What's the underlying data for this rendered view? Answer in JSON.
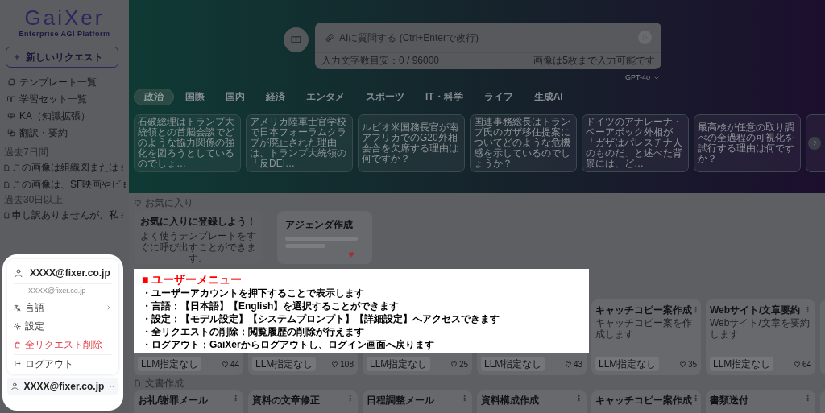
{
  "sidebar": {
    "logo": "GaiXer",
    "tagline": "Enterprise AGI Platform",
    "new_request": "新しいリクエスト",
    "nav": [
      {
        "label": "テンプレート一覧"
      },
      {
        "label": "学習セット一覧"
      },
      {
        "label": "KA（知識拡張）"
      },
      {
        "label": "翻訳・要約"
      }
    ],
    "history": [
      {
        "heading": "過去7日間",
        "items": [
          "この画像は組織図または",
          "この画像は、SF映画やビ"
        ]
      },
      {
        "heading": "過去30日以上",
        "items": [
          "申し訳ありませんが、私"
        ]
      }
    ]
  },
  "hero": {
    "placeholder": "AIに質問する (Ctrl+Enterで改行)",
    "char_count": "入力文字数目安：0 / 96000",
    "image_note": "画像は5枚まで入力可能です",
    "model": "GPT-4o",
    "categories": [
      {
        "label": "政治",
        "selected": true
      },
      {
        "label": "国際",
        "selected": false
      },
      {
        "label": "国内",
        "selected": false
      },
      {
        "label": "経済",
        "selected": false
      },
      {
        "label": "エンタメ",
        "selected": false
      },
      {
        "label": "スポーツ",
        "selected": false
      },
      {
        "label": "IT・科学",
        "selected": false
      },
      {
        "label": "ライフ",
        "selected": false
      },
      {
        "label": "生成AI",
        "selected": false
      }
    ],
    "news": [
      "石破総理はトランプ大統領との首脳会談でどのような協力関係の強化を図ろうとしているのでしょ…",
      "アメリカ陸軍士官学校で日本フォーラムクラブが廃止された理由は、トランプ大統領の「反DEI…",
      "ルビオ米国務長官が南アフリカでのG20外相会合を欠席する理由は何ですか？",
      "国連事務総長はトランプ氏のガザ移住提案についてどのような危機感を示しているのでしょうか？",
      "ドイツのアナレーナ・ベーアボック外相が「ガザはパレスチナ人のものだ」と述べた背景には、ど…",
      "最高検が任意の取り調べの全過程の可視化を試行する理由は何ですか？"
    ]
  },
  "favorites": {
    "heading": "お気に入り",
    "empty_title": "お気に入りに登録しよう！",
    "empty_text": "よく使うテンプレートをすぐに呼び出すことができます。",
    "card_title": "アジェンダ作成"
  },
  "templates": [
    {
      "llm": "LLM指定なし",
      "likes": "44"
    },
    {
      "llm": "LLM指定なし",
      "likes": "108"
    },
    {
      "llm": "LLM指定なし",
      "likes": "25"
    },
    {
      "llm": "LLM指定なし",
      "likes": "43"
    },
    {
      "title": "キャッチコピー案作成",
      "description": "キャッチコピー案を作成します",
      "llm": "LLM指定なし",
      "likes": "35"
    },
    {
      "title": "Webサイト/文章要約",
      "description": "Webサイト/文章を要約します",
      "llm": "LLM指定なし",
      "likes": "64"
    }
  ],
  "documents": {
    "heading": "文書作成",
    "cards": [
      "お礼/謝罪メール",
      "資料の文章修正",
      "日程調整メール",
      "資料構成作成",
      "キャッチコピー案作成",
      "書類送付"
    ]
  },
  "user_menu": {
    "name": "XXXX@fixer.co.jp",
    "email": "XXXX@fixer.co.jp",
    "items": [
      {
        "label": "言語",
        "kind": "submenu"
      },
      {
        "label": "設定",
        "kind": "normal"
      },
      {
        "label": "全リクエスト削除",
        "kind": "danger"
      },
      {
        "label": "ログアウト",
        "kind": "normal"
      }
    ],
    "account": {
      "label": "XXXX@fixer.co.jp",
      "expanded": true
    }
  },
  "annotation": {
    "title": "■ ユーザーメニュー",
    "lines": [
      "・ユーザーアカウントを押下することで表示します",
      "・言語：【日本語】【English】を選択することができます",
      "・設定：【モデル設定】【システムプロンプト】【詳細設定】へアクセスできます",
      "・全リクエストの削除：閲覧履歴の削除が行えます",
      "・ログアウト：GaiXerからログアウトし、ログイン画面へ戻ります"
    ]
  }
}
